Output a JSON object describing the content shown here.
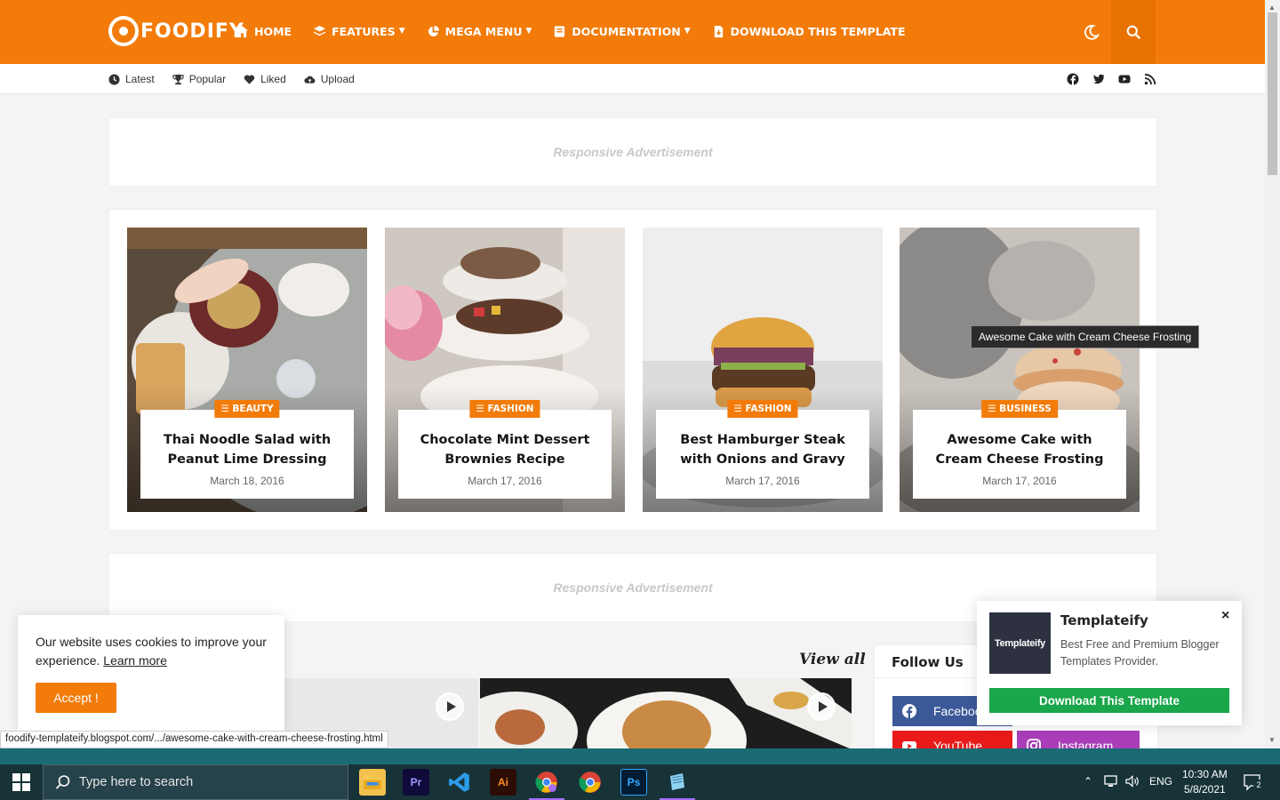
{
  "header": {
    "logo_text": "FOODIFY",
    "nav": [
      {
        "label": "HOME",
        "icon": "home-icon",
        "caret": false
      },
      {
        "label": "FEATURES",
        "icon": "layers-icon",
        "caret": true
      },
      {
        "label": "MEGA MENU",
        "icon": "pie-chart-icon",
        "caret": true
      },
      {
        "label": "DOCUMENTATION",
        "icon": "book-icon",
        "caret": true
      },
      {
        "label": "DOWNLOAD THIS TEMPLATE",
        "icon": "file-download-icon",
        "caret": false
      }
    ],
    "accent": "#f27b0a"
  },
  "subbar": {
    "links": [
      {
        "label": "Latest",
        "icon": "clock-icon"
      },
      {
        "label": "Popular",
        "icon": "trophy-icon"
      },
      {
        "label": "Liked",
        "icon": "heart-icon"
      },
      {
        "label": "Upload",
        "icon": "cloud-upload-icon"
      }
    ],
    "socials": [
      "facebook-icon",
      "twitter-icon",
      "youtube-icon",
      "rss-icon"
    ]
  },
  "ads": {
    "top": "Responsive Advertisement",
    "middle": "Responsive Advertisement"
  },
  "featured": [
    {
      "tag": "BEAUTY",
      "title": "Thai Noodle Salad with Peanut Lime Dressing",
      "date": "March 18, 2016"
    },
    {
      "tag": "FASHION",
      "title": "Chocolate Mint Dessert Brownies Recipe",
      "date": "March 17, 2016"
    },
    {
      "tag": "FASHION",
      "title": "Best Hamburger Steak with Onions and Gravy",
      "date": "March 17, 2016"
    },
    {
      "tag": "BUSINESS",
      "title": "Awesome Cake with Cream Cheese Frosting",
      "date": "March 17, 2016"
    }
  ],
  "tooltip": "Awesome Cake with Cream Cheese Frosting",
  "videos": {
    "view_all": "View all"
  },
  "follow": {
    "title": "Follow Us",
    "buttons": [
      {
        "label": "Facebook",
        "color": "#3b5998"
      },
      {
        "label": "YouTube",
        "color": "#e91a1a"
      },
      {
        "label": "Instagram",
        "color": "#a93eb8"
      }
    ]
  },
  "cookie": {
    "text": "Our website uses cookies to improve your experience.",
    "learn_more": "Learn more",
    "accept": "Accept !"
  },
  "popup": {
    "logo": "Templateify",
    "title": "Templateify",
    "description": "Best Free and Premium Blogger Templates Provider.",
    "button": "Download This Template",
    "close": "×"
  },
  "status_url": "foodify-templateify.blogspot.com/.../awesome-cake-with-cream-cheese-frosting.html",
  "taskbar": {
    "search_placeholder": "Type here to search",
    "apps": [
      "file-explorer-icon",
      "premiere-pro-icon",
      "vscode-icon",
      "illustrator-icon",
      "chrome-profile-icon",
      "chrome-icon",
      "photoshop-icon",
      "notepad-icon"
    ],
    "language": "ENG",
    "time": "10:30 AM",
    "date": "5/8/2021",
    "notifications": "2"
  }
}
